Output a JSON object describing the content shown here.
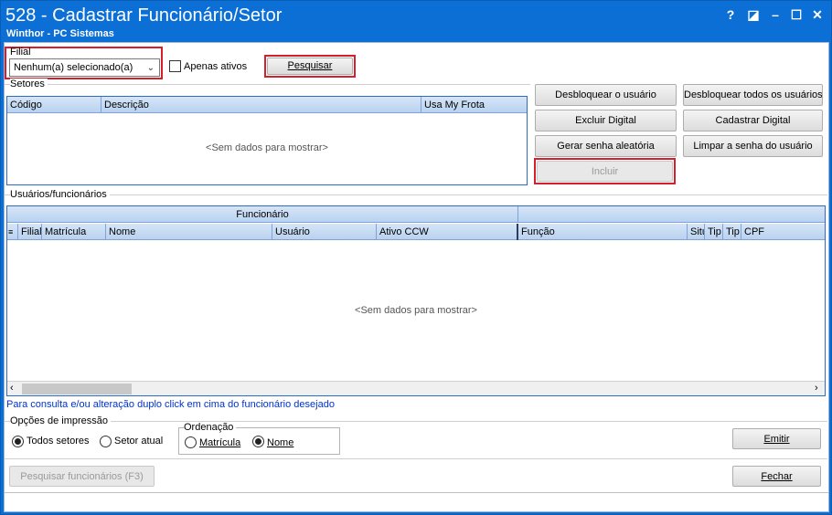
{
  "window": {
    "title": "528 - Cadastrar Funcionário/Setor",
    "subtitle": "Winthor - PC Sistemas",
    "controls": {
      "help": "?",
      "restore": "◪",
      "minimize": "–",
      "maximize": "☐",
      "close": "✕"
    }
  },
  "filter": {
    "filial_label": "Filial",
    "filial_value": "Nenhum(a) selecionado(a)",
    "apenas_ativos_label": "Apenas ativos",
    "pesquisar_label": "Pesquisar"
  },
  "setores": {
    "label": "Setores",
    "columns": [
      "Código",
      "Descrição",
      "Usa My Frota"
    ],
    "empty_text": "<Sem dados para mostrar>"
  },
  "actions": {
    "desbloquear_usuario": "Desbloquear o usuário",
    "desbloquear_todos": "Desbloquear todos os usuários",
    "excluir_digital": "Excluir Digital",
    "cadastrar_digital": "Cadastrar Digital",
    "gerar_senha": "Gerar senha aleatória",
    "limpar_senha": "Limpar a senha do usuário",
    "incluir": "Incluir"
  },
  "usuarios": {
    "label": "Usuários/funcionários",
    "band_label": "Funcionário",
    "columns": [
      "Filial",
      "Matrícula",
      "Nome",
      "Usuário",
      "Ativo CCW",
      "Função",
      "Situ",
      "Tip",
      "Tip",
      "CPF"
    ],
    "empty_text": "<Sem dados para mostrar>"
  },
  "hint": "Para consulta e/ou alteração duplo click em cima do funcionário desejado",
  "impressao": {
    "label": "Opções de impressão",
    "todos_setores": "Todos setores",
    "setor_atual": "Setor atual",
    "selected": "Todos setores"
  },
  "ordenacao": {
    "label": "Ordenação",
    "matricula": "Matrícula",
    "nome": "Nome",
    "selected": "Nome"
  },
  "footer": {
    "emitir": "Emitir",
    "fechar": "Fechar",
    "pesquisar_funcionarios": "Pesquisar funcionários (F3)"
  },
  "colors": {
    "titlebar": "#0b6fd6",
    "highlight": "#d4202a",
    "grid_header": "#b9d2f0",
    "link": "#0033cc"
  }
}
